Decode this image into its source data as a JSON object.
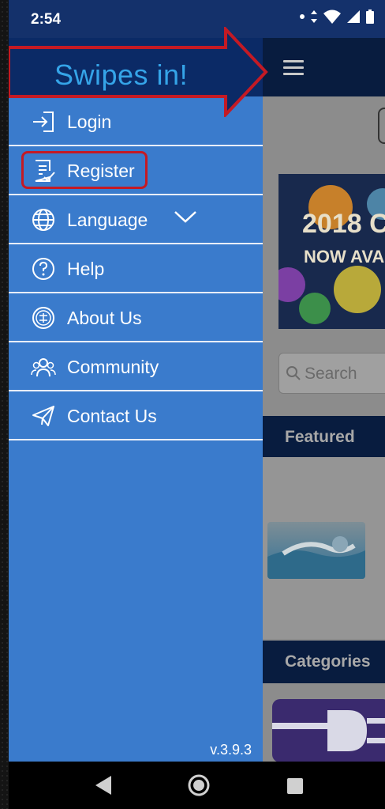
{
  "status_bar": {
    "time": "2:54"
  },
  "annotation": {
    "text": "Swipes in!"
  },
  "drawer": {
    "items": [
      {
        "label": "Login",
        "icon": "login-icon"
      },
      {
        "label": "Register",
        "icon": "register-icon"
      },
      {
        "label": "Language",
        "icon": "globe-icon"
      },
      {
        "label": "Help",
        "icon": "help-icon"
      },
      {
        "label": "About Us",
        "icon": "about-icon"
      },
      {
        "label": "Community",
        "icon": "community-icon"
      },
      {
        "label": "Contact Us",
        "icon": "send-icon"
      }
    ],
    "version": "v.3.9.3"
  },
  "background_app": {
    "banner_title": "2018 C",
    "banner_subtitle": "NOW AVA",
    "search_placeholder": "Search",
    "featured_label": "Featured",
    "categories_label": "Categories"
  },
  "colors": {
    "drawer_bg": "#3a7bcc",
    "header_bg": "#0b2a66",
    "status_bg": "#14316b",
    "highlight": "#c41a24",
    "annotation_text": "#35a4e8"
  }
}
